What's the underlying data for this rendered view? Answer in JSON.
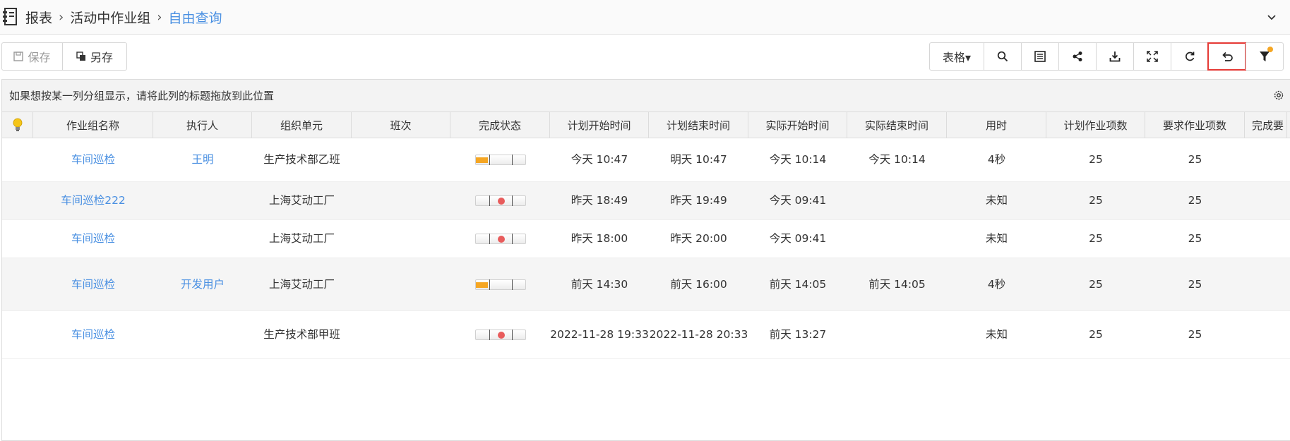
{
  "breadcrumb": {
    "items": [
      "报表",
      "活动中作业组",
      "自由查询"
    ],
    "separator": "›"
  },
  "toolbar": {
    "save_label": "保存",
    "saveas_label": "另存",
    "view_label": "表格▾",
    "tools": [
      "search-icon",
      "table-settings-icon",
      "share-icon",
      "download-icon",
      "fullscreen-icon",
      "refresh-icon",
      "undo-icon",
      "filter-icon"
    ]
  },
  "grid": {
    "group_hint": "如果想按某一列分组显示，请将此列的标题拖放到此位置",
    "columns": [
      "",
      "作业组名称",
      "执行人",
      "组织单元",
      "班次",
      "完成状态",
      "计划开始时间",
      "计划结束时间",
      "实际开始时间",
      "实际结束时间",
      "用时",
      "计划作业项数",
      "要求作业项数",
      "完成要"
    ],
    "rows": [
      {
        "name": "车间巡检",
        "executor": "王明",
        "org": "生产技术部乙班",
        "shift": "",
        "progress": 0.25,
        "overdue": false,
        "plan_start": "今天 10:47",
        "plan_end": "明天 10:47",
        "actual_start": "今天 10:14",
        "actual_end": "今天 10:14",
        "duration": "4秒",
        "plan_items": "25",
        "req_items": "25"
      },
      {
        "name": "车间巡检222",
        "executor": "",
        "org": "上海艾动工厂",
        "shift": "",
        "progress": 0,
        "overdue": true,
        "plan_start": "昨天 18:49",
        "plan_end": "昨天 19:49",
        "actual_start": "今天 09:41",
        "actual_end": "",
        "duration": "未知",
        "plan_items": "25",
        "req_items": "25"
      },
      {
        "name": "车间巡检",
        "executor": "",
        "org": "上海艾动工厂",
        "shift": "",
        "progress": 0,
        "overdue": true,
        "plan_start": "昨天 18:00",
        "plan_end": "昨天 20:00",
        "actual_start": "今天 09:41",
        "actual_end": "",
        "duration": "未知",
        "plan_items": "25",
        "req_items": "25"
      },
      {
        "name": "车间巡检",
        "executor": "开发用户",
        "org": "上海艾动工厂",
        "shift": "",
        "progress": 0.25,
        "overdue": false,
        "plan_start": "前天 14:30",
        "plan_end": "前天 16:00",
        "actual_start": "前天 14:05",
        "actual_end": "前天 14:05",
        "duration": "4秒",
        "plan_items": "25",
        "req_items": "25"
      },
      {
        "name": "车间巡检",
        "executor": "",
        "org": "生产技术部甲班",
        "shift": "",
        "progress": 0,
        "overdue": true,
        "plan_start": "2022-11-28 19:33",
        "plan_end": "2022-11-28 20:33",
        "actual_start": "前天 13:27",
        "actual_end": "",
        "duration": "未知",
        "plan_items": "25",
        "req_items": "25"
      }
    ]
  },
  "colors": {
    "link": "#4a90e2",
    "progress": "#f5a623",
    "overdue": "#e85c5c",
    "highlight": "#e53935",
    "filter_dot": "#f5a623"
  }
}
